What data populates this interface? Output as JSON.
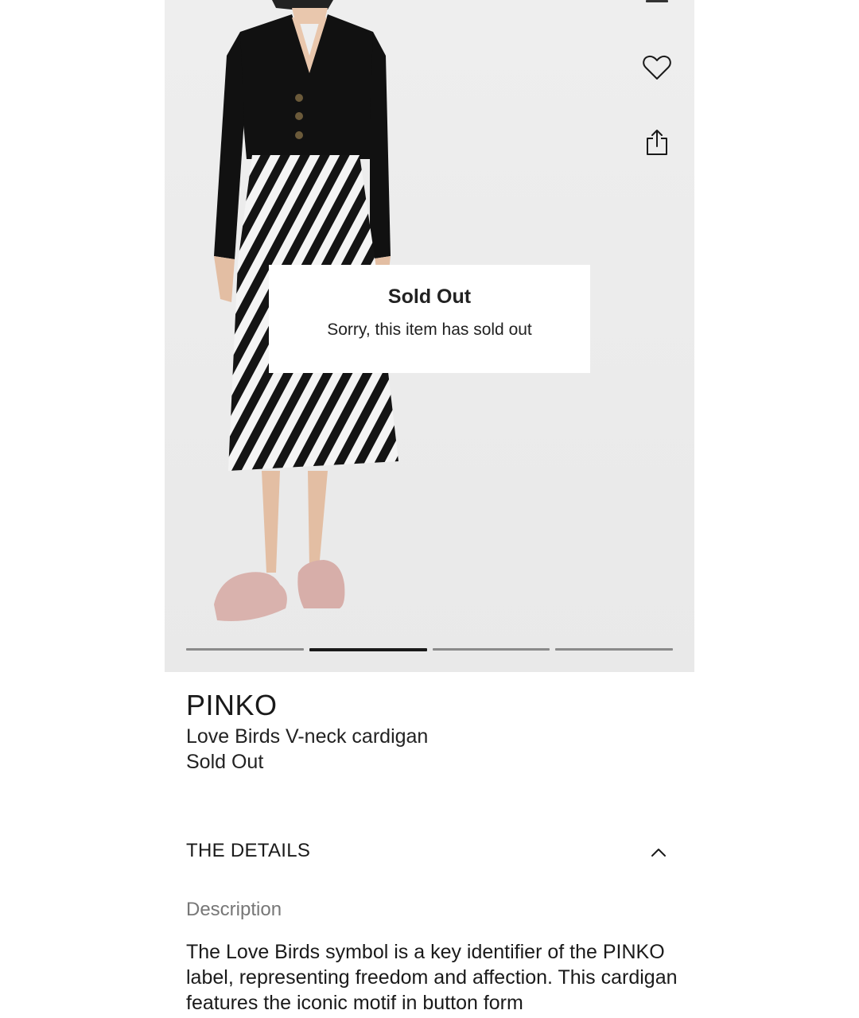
{
  "gallery": {
    "image_alt": "Model wearing black V-neck cardigan with zebra print skirt and pink clogs",
    "slide_count": 4,
    "active_slide": 2
  },
  "overlay": {
    "title": "Sold Out",
    "message": "Sorry, this item has sold out"
  },
  "product": {
    "brand": "PINKO",
    "name": "Love Birds V-neck cardigan",
    "status": "Sold Out"
  },
  "details": {
    "section_title": "THE DETAILS",
    "description_label": "Description",
    "description_text": "The Love Birds symbol is a key identifier of the PINKO label, representing freedom and affection. This cardigan features the iconic motif in button form"
  },
  "icons": {
    "wishlist": "heart-icon",
    "share": "share-icon",
    "toggle": "chevron-up-icon"
  }
}
